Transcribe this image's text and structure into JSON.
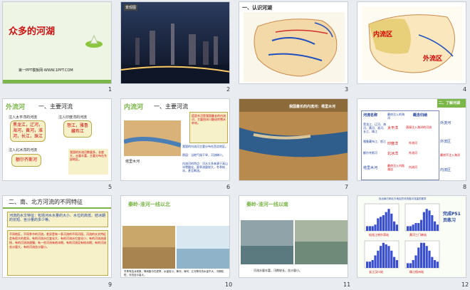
{
  "slides": [
    {
      "n": "1",
      "title": "众多的河湖",
      "footer": "第一PPT模板网-WWW.1PPT.COM"
    },
    {
      "n": "2",
      "badge": "景观图"
    },
    {
      "n": "3",
      "heading": "一、认识河湖"
    },
    {
      "n": "4",
      "inner": "内流区",
      "outer": "外流区"
    },
    {
      "n": "5",
      "tab": "外流河",
      "heading": "一、主要河流",
      "box1_title": "注入太平洋的河流",
      "box1_text": "黑龙江，辽河，海河，黄河，淮河，长江，珠江",
      "box2_title": "注入印度洋的河流",
      "box2_text": "怒江，雅鲁藏布江",
      "box3_title": "注入北冰洋的河流",
      "box3_text": "额尔齐斯河",
      "note": "我国的外流河数量多，长度大，水量丰富，主要分布在东部地区。"
    },
    {
      "n": "6",
      "tab": "内流河",
      "heading": "一、主要河流",
      "caption": "塔里木河",
      "side_note": "塔里木河是我国最长的内流河，主要由冰川融化的雪水补给。",
      "body1": "我国的内流河主要分布在西北地区。",
      "body2": "原因：当地气候干旱，河流稀少。",
      "body3": "内流河的特点：河水大多来源于高山冰雪融化，夏季流量较大，冬季结冰，甚至断流。"
    },
    {
      "n": "7",
      "caption": "我国最长的内流河：塔里木河"
    },
    {
      "n": "8",
      "heading": "二、了解河湖",
      "col1": "河流名称",
      "col2": "最终注入的海洋",
      "col3": "概念归纳",
      "rows": [
        {
          "name": "黑龙江、辽河、海河、黄河、淮河、长江、珠江",
          "ocean": "太平洋",
          "concept": "直接注入海洋的河流"
        },
        {
          "name": "雅鲁藏布江、怒江",
          "ocean": "印度洋",
          "concept": "外流河"
        },
        {
          "name": "额尔齐斯河",
          "ocean": "北冰洋",
          "concept": "外流河"
        },
        {
          "name": "塔里木河",
          "ocean": "最终注入内陆湖泊",
          "concept": "内流河"
        }
      ],
      "right1": "外流河",
      "right2": "外流区",
      "right3": "最终不注入海洋",
      "right4": "内流区"
    },
    {
      "n": "9",
      "heading": "二、南、北方河流的不同特征",
      "box": "河流的水文特征：包括河水水量的大小、水位的高低、结冰期的长短、含沙量的多少等。",
      "text": "不同地区，不同季节的河流，差异是有一条河流的不同河段，河流的水文特征会有很大的差异。有的河流水位变化大，有的河流水位变化小；有的河流流速快，有的河流流速慢；有一些河流有结冰期，有的河流没有结冰期；有的河流含沙量大，有的河流含沙量小。"
    },
    {
      "n": "10",
      "title": "秦岭-淮河一线以北",
      "caption": "冬季有结冰现象，降雨集中在夏季，水量较小。黄河、海河、辽河等河流水量不大，汛期较短，河流含沙量大。"
    },
    {
      "n": "11",
      "title": "秦岭-淮河一线以南",
      "caption": "河流水量丰富，汛期较长，含沙量小。"
    },
    {
      "n": "12",
      "heading": "找出南方和北方地区的河流各月流量的差异",
      "right": "完成P51页练习",
      "c1": "松花江哈尔滨站",
      "c2": "黄河三门峡站",
      "c3": "长江汉口站",
      "c4": "珠江梧州站",
      "v1": [
        3,
        3,
        3,
        4,
        8,
        9,
        10,
        12,
        14,
        11,
        6,
        4
      ],
      "v2": [
        3,
        3,
        4,
        5,
        5,
        7,
        12,
        14,
        13,
        10,
        6,
        4
      ],
      "v3": [
        4,
        4,
        5,
        8,
        11,
        14,
        16,
        15,
        14,
        11,
        7,
        5
      ],
      "v4": [
        3,
        3,
        5,
        8,
        13,
        16,
        16,
        14,
        11,
        7,
        5,
        4
      ]
    }
  ]
}
